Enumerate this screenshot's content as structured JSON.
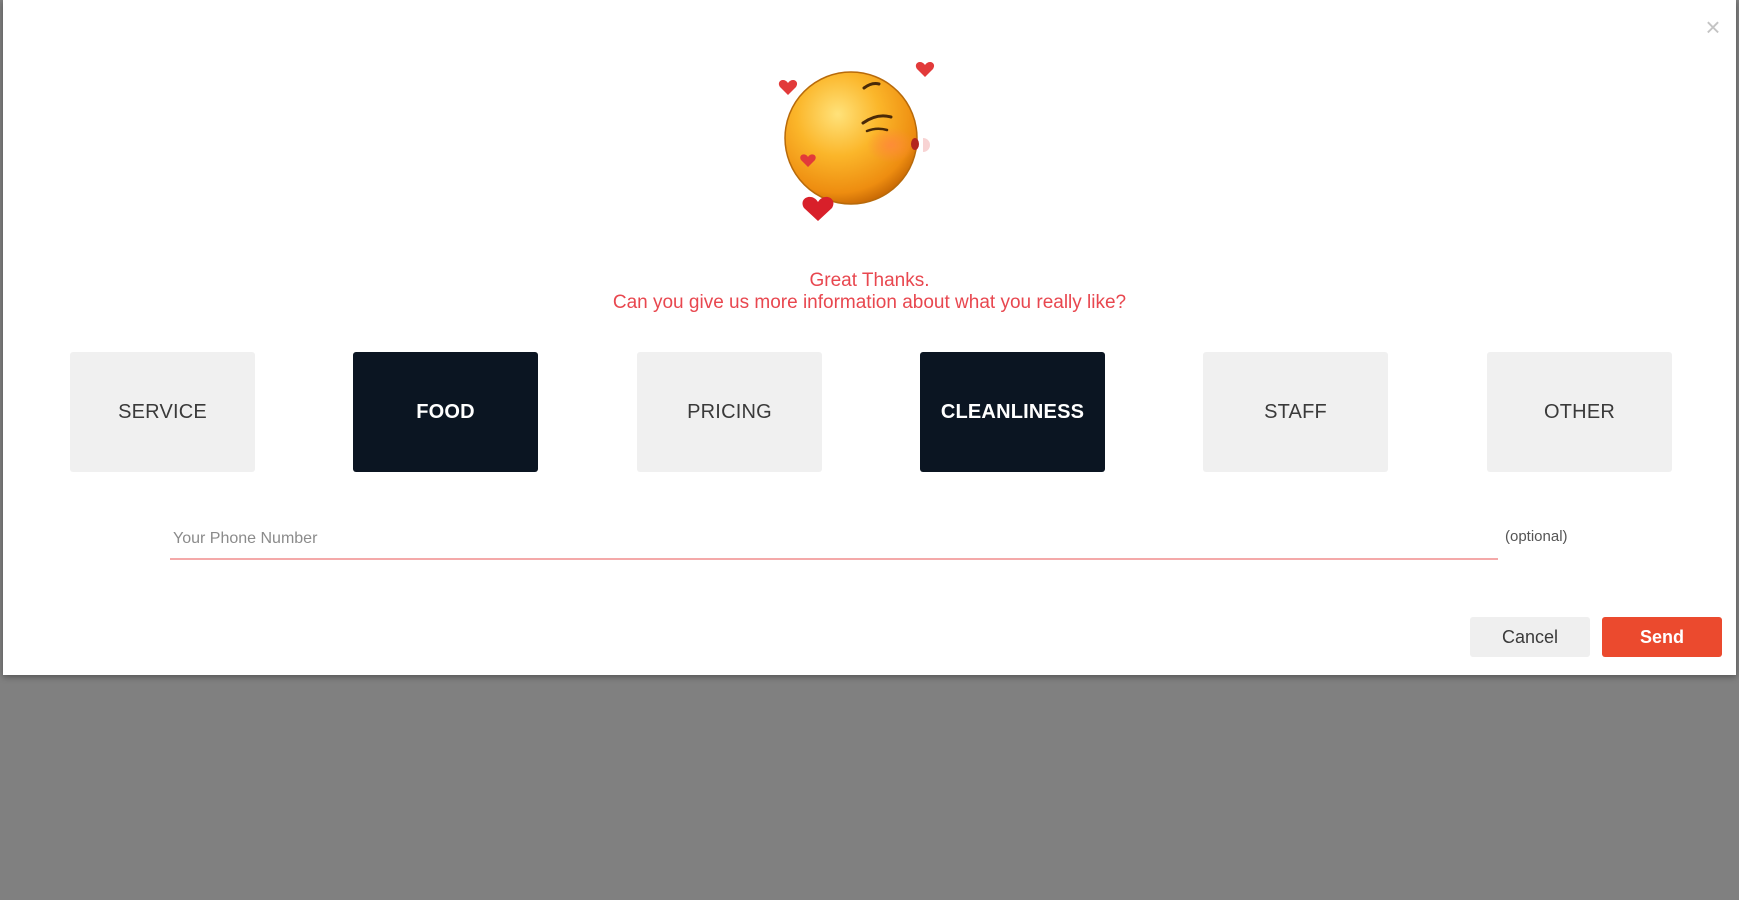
{
  "dialog": {
    "close_symbol": "×",
    "icon": "kissing-face-emoji",
    "headline_line1": "Great Thanks.",
    "headline_line2": "Can you give us more information about what you really like?",
    "categories": [
      {
        "label": "SERVICE",
        "selected": false
      },
      {
        "label": "FOOD",
        "selected": true
      },
      {
        "label": "PRICING",
        "selected": false
      },
      {
        "label": "CLEANLINESS",
        "selected": true
      },
      {
        "label": "STAFF",
        "selected": false
      },
      {
        "label": "OTHER",
        "selected": false
      }
    ],
    "phone": {
      "placeholder": "Your Phone Number",
      "value": "",
      "optional_label": "(optional)"
    },
    "buttons": {
      "cancel": "Cancel",
      "send": "Send"
    }
  },
  "colors": {
    "accent": "#e8474f",
    "send_button": "#eb4a2e",
    "selected_category": "#0b1522",
    "unselected_category": "#f0f0f0",
    "overlay": "#808080"
  }
}
